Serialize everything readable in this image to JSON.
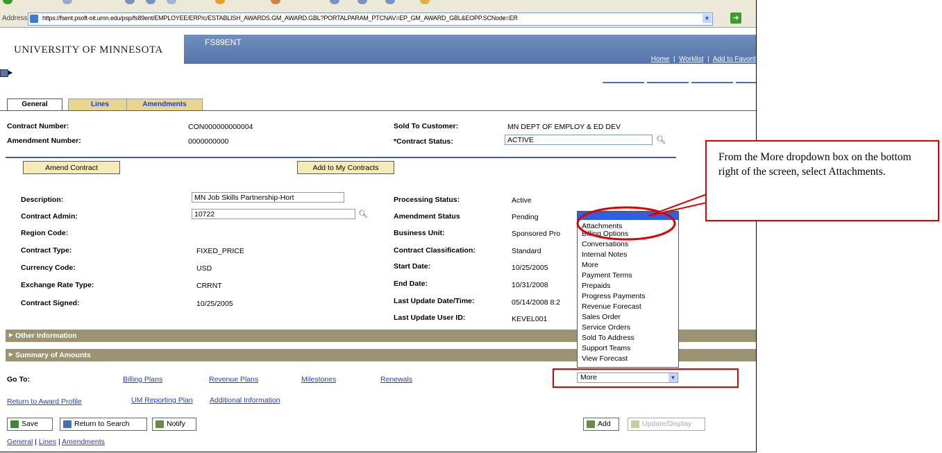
{
  "browser": {
    "address_label": "Address",
    "url": "https://fsent.psoft-oit.umn.edu/psp/fs89ent/EMPLOYEE/ERP/c/ESTABLISH_AWARDS.GM_AWARD.GBL?PORTALPARAM_PTCNAV=EP_GM_AWARD_GBL&EOPP.SCNode=ER"
  },
  "header": {
    "university": "UNIVERSITY OF MINNESOTA",
    "system": "FS89ENT",
    "links": [
      "Home",
      "Worklist",
      "Add to Favorit"
    ]
  },
  "tabs": [
    "General",
    "Lines",
    "Amendments"
  ],
  "contract": {
    "contract_number_label": "Contract Number:",
    "contract_number": "CON000000000004",
    "amendment_number_label": "Amendment Number:",
    "amendment_number": "0000000000",
    "sold_to_label": "Sold To Customer:",
    "sold_to": "MN DEPT OF EMPLOY & ED DEV",
    "status_label": "*Contract Status:",
    "status": "ACTIVE"
  },
  "buttons": {
    "amend": "Amend Contract",
    "add_my": "Add to My Contracts"
  },
  "details_left": [
    {
      "label": "Description:",
      "value": "MN Job Skills Partnership-Hort"
    },
    {
      "label": "Contract Admin:",
      "value": "10722"
    },
    {
      "label": "Region Code:",
      "value": ""
    },
    {
      "label": "Contract Type:",
      "value": "FIXED_PRICE"
    },
    {
      "label": "Currency Code:",
      "value": "USD"
    },
    {
      "label": "Exchange Rate Type:",
      "value": "CRRNT"
    },
    {
      "label": "Contract Signed:",
      "value": "10/25/2005"
    }
  ],
  "details_right": [
    {
      "label": "Processing Status:",
      "value": "Active"
    },
    {
      "label": "Amendment Status",
      "value": "Pending"
    },
    {
      "label": "Business Unit:",
      "value": "Sponsored Pro"
    },
    {
      "label": "Contract Classification:",
      "value": "Standard"
    },
    {
      "label": "Start Date:",
      "value": "10/25/2005"
    },
    {
      "label": "End Date:",
      "value": "10/31/2008"
    },
    {
      "label": "Last Update Date/Time:",
      "value": "05/14/2008 8:2"
    },
    {
      "label": "Last Update User ID:",
      "value": "KEVEL001"
    }
  ],
  "sections": [
    "Other Information",
    "Summary of Amounts"
  ],
  "dropdown_options": [
    "Attachments",
    "Billing Options",
    "Conversations",
    "Internal Notes",
    "More",
    "Payment Terms",
    "Prepaids",
    "Progress Payments",
    "Revenue Forecast",
    "Sales Order",
    "Service Orders",
    "Sold To Address",
    "Support Teams",
    "View Forecast"
  ],
  "goto": {
    "label": "Go To:",
    "links": [
      "Billing Plans",
      "Revenue Plans",
      "Milestones",
      "Renewals"
    ],
    "more_value": "More"
  },
  "links_row": [
    "Return to Award Profile",
    "UM Reporting Plan",
    "Additional Information"
  ],
  "toolbar": {
    "save": "Save",
    "return": "Return to Search",
    "notify": "Notify",
    "add": "Add",
    "update": "Update/Display"
  },
  "bottom_nav": [
    "General",
    "Lines",
    "Amendments"
  ],
  "callout": "From the More dropdown box on the bottom right of the screen, select Attachments.",
  "colors": {
    "header_blue": "#5674a8",
    "section_bar": "#9b9371",
    "tab_gold": "#e8d590",
    "link": "#1f3fc4",
    "highlight_red": "#e00000"
  }
}
